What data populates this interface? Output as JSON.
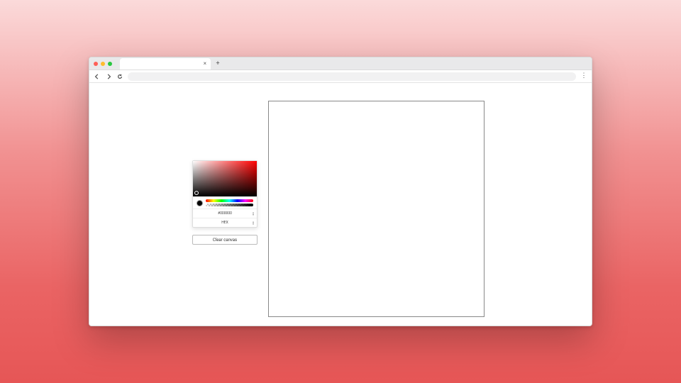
{
  "browser": {
    "tab_close_glyph": "×",
    "new_tab_glyph": "+",
    "kebab_glyph": "⋮"
  },
  "colorpicker": {
    "hex_value": "#000000",
    "format_label": "HEX",
    "base_hue": "#ff0000"
  },
  "controls": {
    "clear_label": "Clear canvas"
  }
}
